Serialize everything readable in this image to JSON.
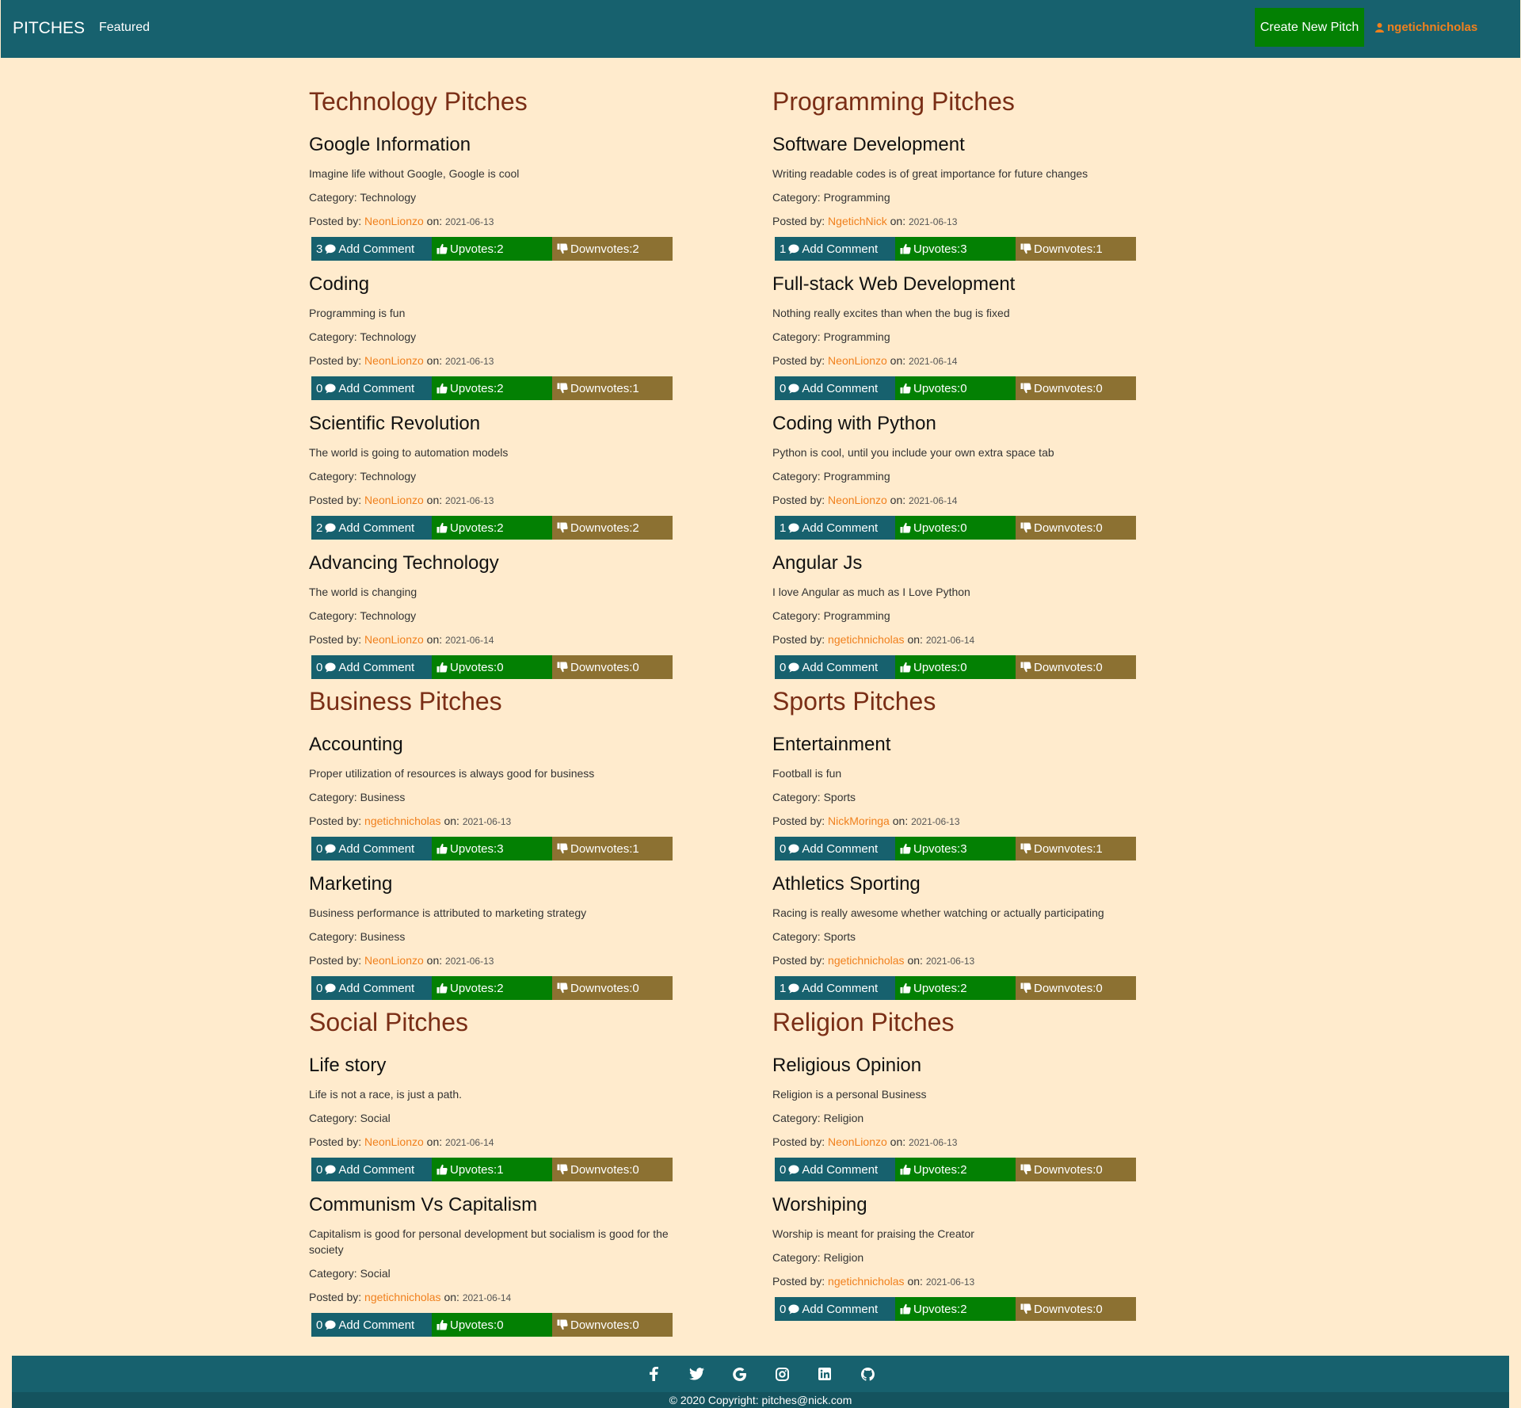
{
  "nav": {
    "brand": "PITCHES",
    "featured": "Featured",
    "create": "Create New Pitch",
    "user": "ngetichnicholas"
  },
  "labels": {
    "add_comment": "Add Comment",
    "category_prefix": "Category: ",
    "posted_by": "Posted by: ",
    "on": "on: ",
    "upvotes": "Upvotes: ",
    "downvotes": "Downvotes: "
  },
  "sections": [
    {
      "title": "Technology Pitches",
      "pitches": [
        {
          "title": "Google Information",
          "desc": "Imagine life without Google, Google is cool",
          "category": "Technology",
          "author": "NeonLionzo",
          "date": "2021-06-13",
          "comments": "3",
          "upvotes": "2",
          "downvotes": "2"
        },
        {
          "title": "Coding",
          "desc": "Programming is fun",
          "category": "Technology",
          "author": "NeonLionzo",
          "date": "2021-06-13",
          "comments": "0",
          "upvotes": "2",
          "downvotes": "1"
        },
        {
          "title": "Scientific Revolution",
          "desc": "The world is going to automation models",
          "category": "Technology",
          "author": "NeonLionzo",
          "date": "2021-06-13",
          "comments": "2",
          "upvotes": "2",
          "downvotes": "2"
        },
        {
          "title": "Advancing Technology",
          "desc": "The world is changing",
          "category": "Technology",
          "author": "NeonLionzo",
          "date": "2021-06-14",
          "comments": "0",
          "upvotes": "0",
          "downvotes": "0"
        }
      ]
    },
    {
      "title": "Programming Pitches",
      "pitches": [
        {
          "title": "Software Development",
          "desc": "Writing readable codes is of great importance for future changes",
          "category": "Programming",
          "author": "NgetichNick",
          "date": "2021-06-13",
          "comments": "1",
          "upvotes": "3",
          "downvotes": "1"
        },
        {
          "title": "Full-stack Web Development",
          "desc": "Nothing really excites than when the bug is fixed",
          "category": "Programming",
          "author": "NeonLionzo",
          "date": "2021-06-14",
          "comments": "0",
          "upvotes": "0",
          "downvotes": "0"
        },
        {
          "title": "Coding with Python",
          "desc": "Python is cool, until you include your own extra space tab",
          "category": "Programming",
          "author": "NeonLionzo",
          "date": "2021-06-14",
          "comments": "1",
          "upvotes": "0",
          "downvotes": "0"
        },
        {
          "title": "Angular Js",
          "desc": "I love Angular as much as I Love Python",
          "category": "Programming",
          "author": "ngetichnicholas",
          "date": "2021-06-14",
          "comments": "0",
          "upvotes": "0",
          "downvotes": "0"
        }
      ]
    },
    {
      "title": "Business Pitches",
      "pitches": [
        {
          "title": "Accounting",
          "desc": "Proper utilization of resources is always good for business",
          "category": "Business",
          "author": "ngetichnicholas",
          "date": "2021-06-13",
          "comments": "0",
          "upvotes": "3",
          "downvotes": "1"
        },
        {
          "title": "Marketing",
          "desc": "Business performance is attributed to marketing strategy",
          "category": "Business",
          "author": "NeonLionzo",
          "date": "2021-06-13",
          "comments": "0",
          "upvotes": "2",
          "downvotes": "0"
        }
      ]
    },
    {
      "title": "Sports Pitches",
      "pitches": [
        {
          "title": "Entertainment",
          "desc": "Football is fun",
          "category": "Sports",
          "author": "NickMoringa",
          "date": "2021-06-13",
          "comments": "0",
          "upvotes": "3",
          "downvotes": "1"
        },
        {
          "title": "Athletics Sporting",
          "desc": "Racing is really awesome whether watching or actually participating",
          "category": "Sports",
          "author": "ngetichnicholas",
          "date": "2021-06-13",
          "comments": "1",
          "upvotes": "2",
          "downvotes": "0"
        }
      ]
    },
    {
      "title": "Social Pitches",
      "pitches": [
        {
          "title": "Life story",
          "desc": "Life is not a race, is just a path.",
          "category": "Social",
          "author": "NeonLionzo",
          "date": "2021-06-14",
          "comments": "0",
          "upvotes": "1",
          "downvotes": "0"
        },
        {
          "title": "Communism Vs Capitalism",
          "desc": "Capitalism is good for personal development but socialism is good for the society",
          "category": "Social",
          "author": "ngetichnicholas",
          "date": "2021-06-14",
          "comments": "0",
          "upvotes": "0",
          "downvotes": "0"
        }
      ]
    },
    {
      "title": "Religion Pitches",
      "pitches": [
        {
          "title": "Religious Opinion",
          "desc": "Religion is a personal Business",
          "category": "Religion",
          "author": "NeonLionzo",
          "date": "2021-06-13",
          "comments": "0",
          "upvotes": "2",
          "downvotes": "0"
        },
        {
          "title": "Worshiping",
          "desc": "Worship is meant for praising the Creator",
          "category": "Religion",
          "author": "ngetichnicholas",
          "date": "2021-06-13",
          "comments": "0",
          "upvotes": "2",
          "downvotes": "0"
        }
      ]
    }
  ],
  "footer": {
    "icons": [
      "facebook-icon",
      "twitter-icon",
      "google-icon",
      "instagram-icon",
      "linkedin-icon",
      "github-icon"
    ],
    "copyright": "© 2020 Copyright: pitches@nick.com"
  },
  "colors": {
    "navbar": "#17616e",
    "create_button": "#038003",
    "user_link": "#f0801d",
    "comment_bar": "#17616e",
    "upvote_bar": "#038003",
    "downvote_bar": "#8c7132",
    "section_title": "#7a2e16",
    "background": "#ffebcd"
  }
}
